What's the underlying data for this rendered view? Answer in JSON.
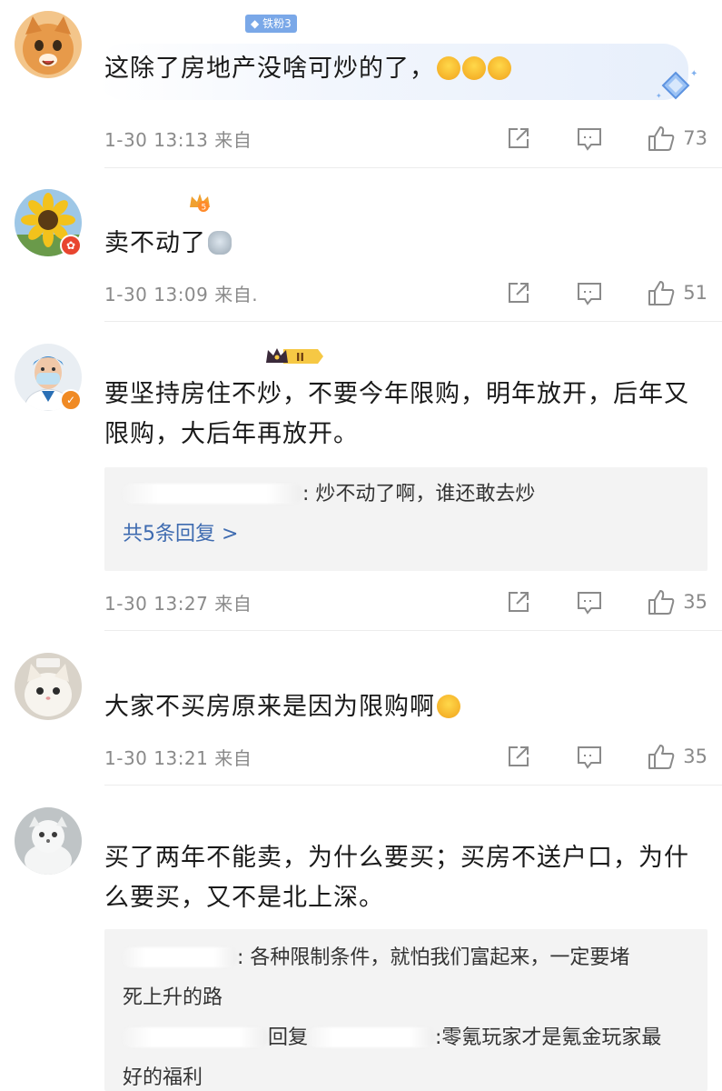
{
  "comments": [
    {
      "id": "c1",
      "badge": "铁粉3",
      "text": "这除了房地产没啥可炒的了，",
      "emoji": "laughing-emoji",
      "time": "1-30 13:13",
      "source": "来自",
      "likes": "73"
    },
    {
      "id": "c2",
      "text": "卖不动了",
      "emoji": "robot-emoji",
      "time": "1-30 13:09",
      "source": "来自.",
      "likes": "51"
    },
    {
      "id": "c3",
      "badge": "II",
      "text_line1": "要坚持房住不炒，不要今年限购，明年放开，后年又",
      "text_line2": "限购，大后年再放开。",
      "reply_preview": ": 炒不动了啊，谁还敢去炒",
      "reply_more": "共5条回复 >",
      "time": "1-30 13:27",
      "source": "来自",
      "likes": "35"
    },
    {
      "id": "c4",
      "text": "大家不买房原来是因为限购啊",
      "emoji": "thinking-emoji",
      "time": "1-30 13:21",
      "source": "来自",
      "likes": "35"
    },
    {
      "id": "c5",
      "text_line1": "买了两年不能卖，为什么要买；买房不送户口，为什",
      "text_line2": "么要买，又不是北上深。",
      "reply1_line1": ": 各种限制条件，就怕我们富起来，一定要堵",
      "reply1_line2": "死上升的路",
      "reply2_mid": "回复",
      "reply2_line1": ":零氪玩家才是氪金玩家最",
      "reply2_line2": "好的福利"
    }
  ],
  "colors": {
    "link": "#3e6bb0",
    "meta_gray": "#8a8a8a",
    "reply_bg": "#f3f3f3",
    "badge_blue": "#7aa8e8",
    "verified_orange": "#f08a24",
    "verified_red": "#e8452f"
  },
  "icons": [
    "share-icon",
    "comment-icon",
    "like-icon"
  ]
}
